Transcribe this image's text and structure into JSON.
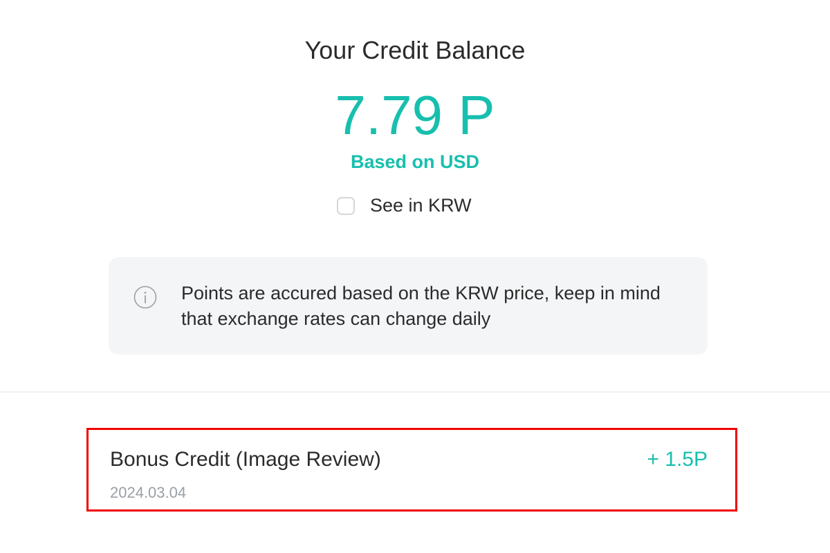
{
  "balance": {
    "title": "Your Credit Balance",
    "amount": "7.79 P",
    "basis": "Based on USD",
    "krw_toggle": {
      "label": "See in KRW",
      "checked": false
    }
  },
  "notice": {
    "icon": "info-icon",
    "text": "Points are accured based on the KRW price, keep in mind that exchange rates can change daily"
  },
  "history": [
    {
      "title": "Bonus Credit (Image Review)",
      "date": "2024.03.04",
      "amount": "+ 1.5P"
    }
  ],
  "colors": {
    "accent": "#17bfae",
    "text": "#2b2b2b",
    "muted": "#9aa0a6",
    "notice_bg": "#f4f5f7",
    "highlight": "#f00000"
  }
}
